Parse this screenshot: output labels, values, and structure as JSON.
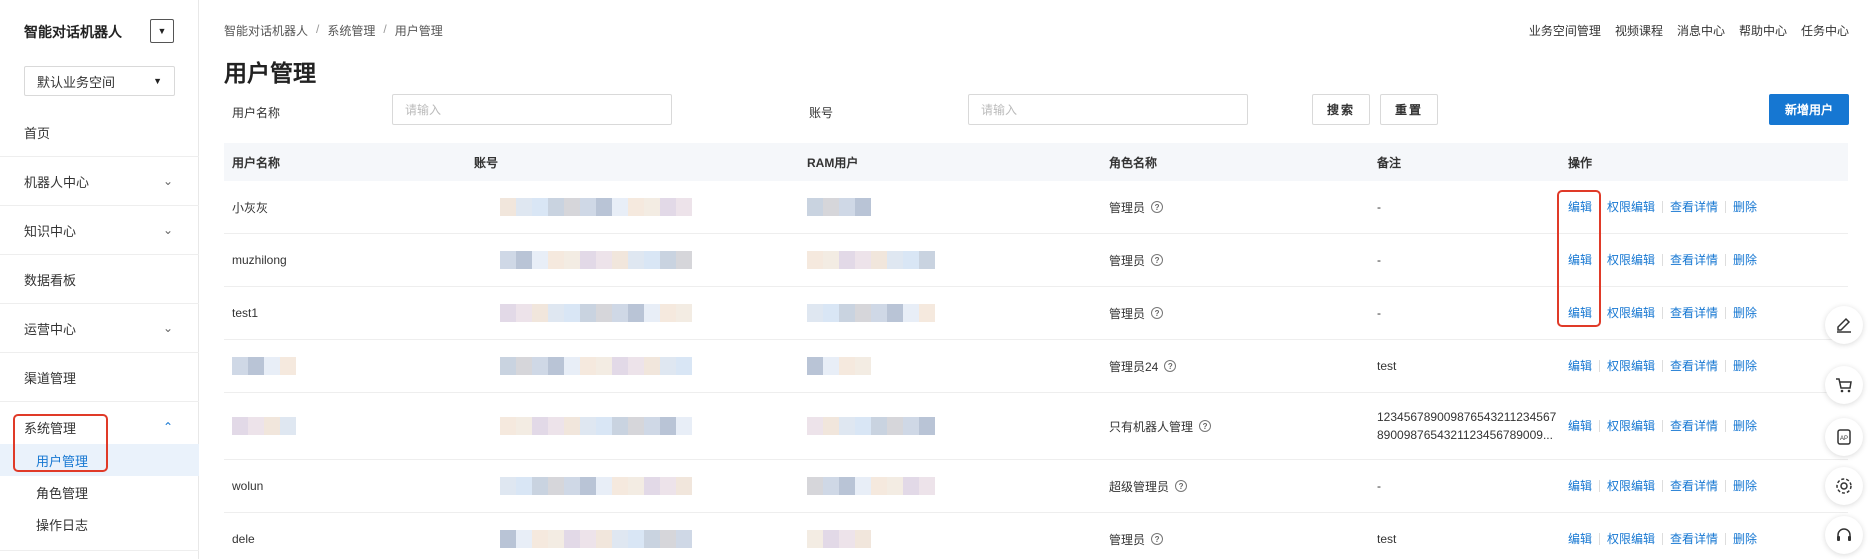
{
  "sidebar": {
    "brand": "智能对话机器人",
    "workspace": "默认业务空间",
    "items": [
      {
        "label": "首页",
        "chevron": false
      },
      {
        "label": "机器人中心",
        "chevron": true
      },
      {
        "label": "知识中心",
        "chevron": true
      },
      {
        "label": "数据看板",
        "chevron": false
      },
      {
        "label": "运营中心",
        "chevron": true
      },
      {
        "label": "渠道管理",
        "chevron": false
      }
    ],
    "system": {
      "label": "系统管理",
      "children": [
        "用户管理",
        "角色管理",
        "操作日志"
      ],
      "active": "用户管理"
    }
  },
  "breadcrumb": [
    "智能对话机器人",
    "系统管理",
    "用户管理"
  ],
  "page_title": "用户管理",
  "topnav": [
    "业务空间管理",
    "视频课程",
    "消息中心",
    "帮助中心",
    "任务中心"
  ],
  "filters": {
    "username_label": "用户名称",
    "username_placeholder": "请输入",
    "account_label": "账号",
    "account_placeholder": "请输入",
    "search_label": "搜索",
    "reset_label": "重置",
    "new_user_label": "新增用户"
  },
  "table": {
    "columns": [
      "用户名称",
      "账号",
      "RAM用户",
      "角色名称",
      "备注",
      "操作"
    ],
    "rows": [
      {
        "name": "小灰灰",
        "role": "管理员",
        "remark": "-"
      },
      {
        "name": "muzhilong",
        "role": "管理员",
        "remark": "-"
      },
      {
        "name": "test1",
        "role": "管理员",
        "remark": "-"
      },
      {
        "name": "",
        "role": "管理员24",
        "remark": "test"
      },
      {
        "name": "",
        "role": "只有机器人管理",
        "remark": "123456789009876543211234567",
        "remark2": "8900987654321123456789009..."
      },
      {
        "name": "wolun",
        "role": "超级管理员",
        "remark": "-"
      },
      {
        "name": "dele",
        "role": "管理员",
        "remark": "test"
      }
    ],
    "ops": [
      "编辑",
      "权限编辑",
      "查看详情",
      "删除"
    ]
  },
  "colors": {
    "accent": "#1677d2",
    "highlight": "#e03a28"
  },
  "float_tools": [
    "edit-icon",
    "cart-icon",
    "api-icon",
    "gear-icon",
    "headset-icon"
  ]
}
